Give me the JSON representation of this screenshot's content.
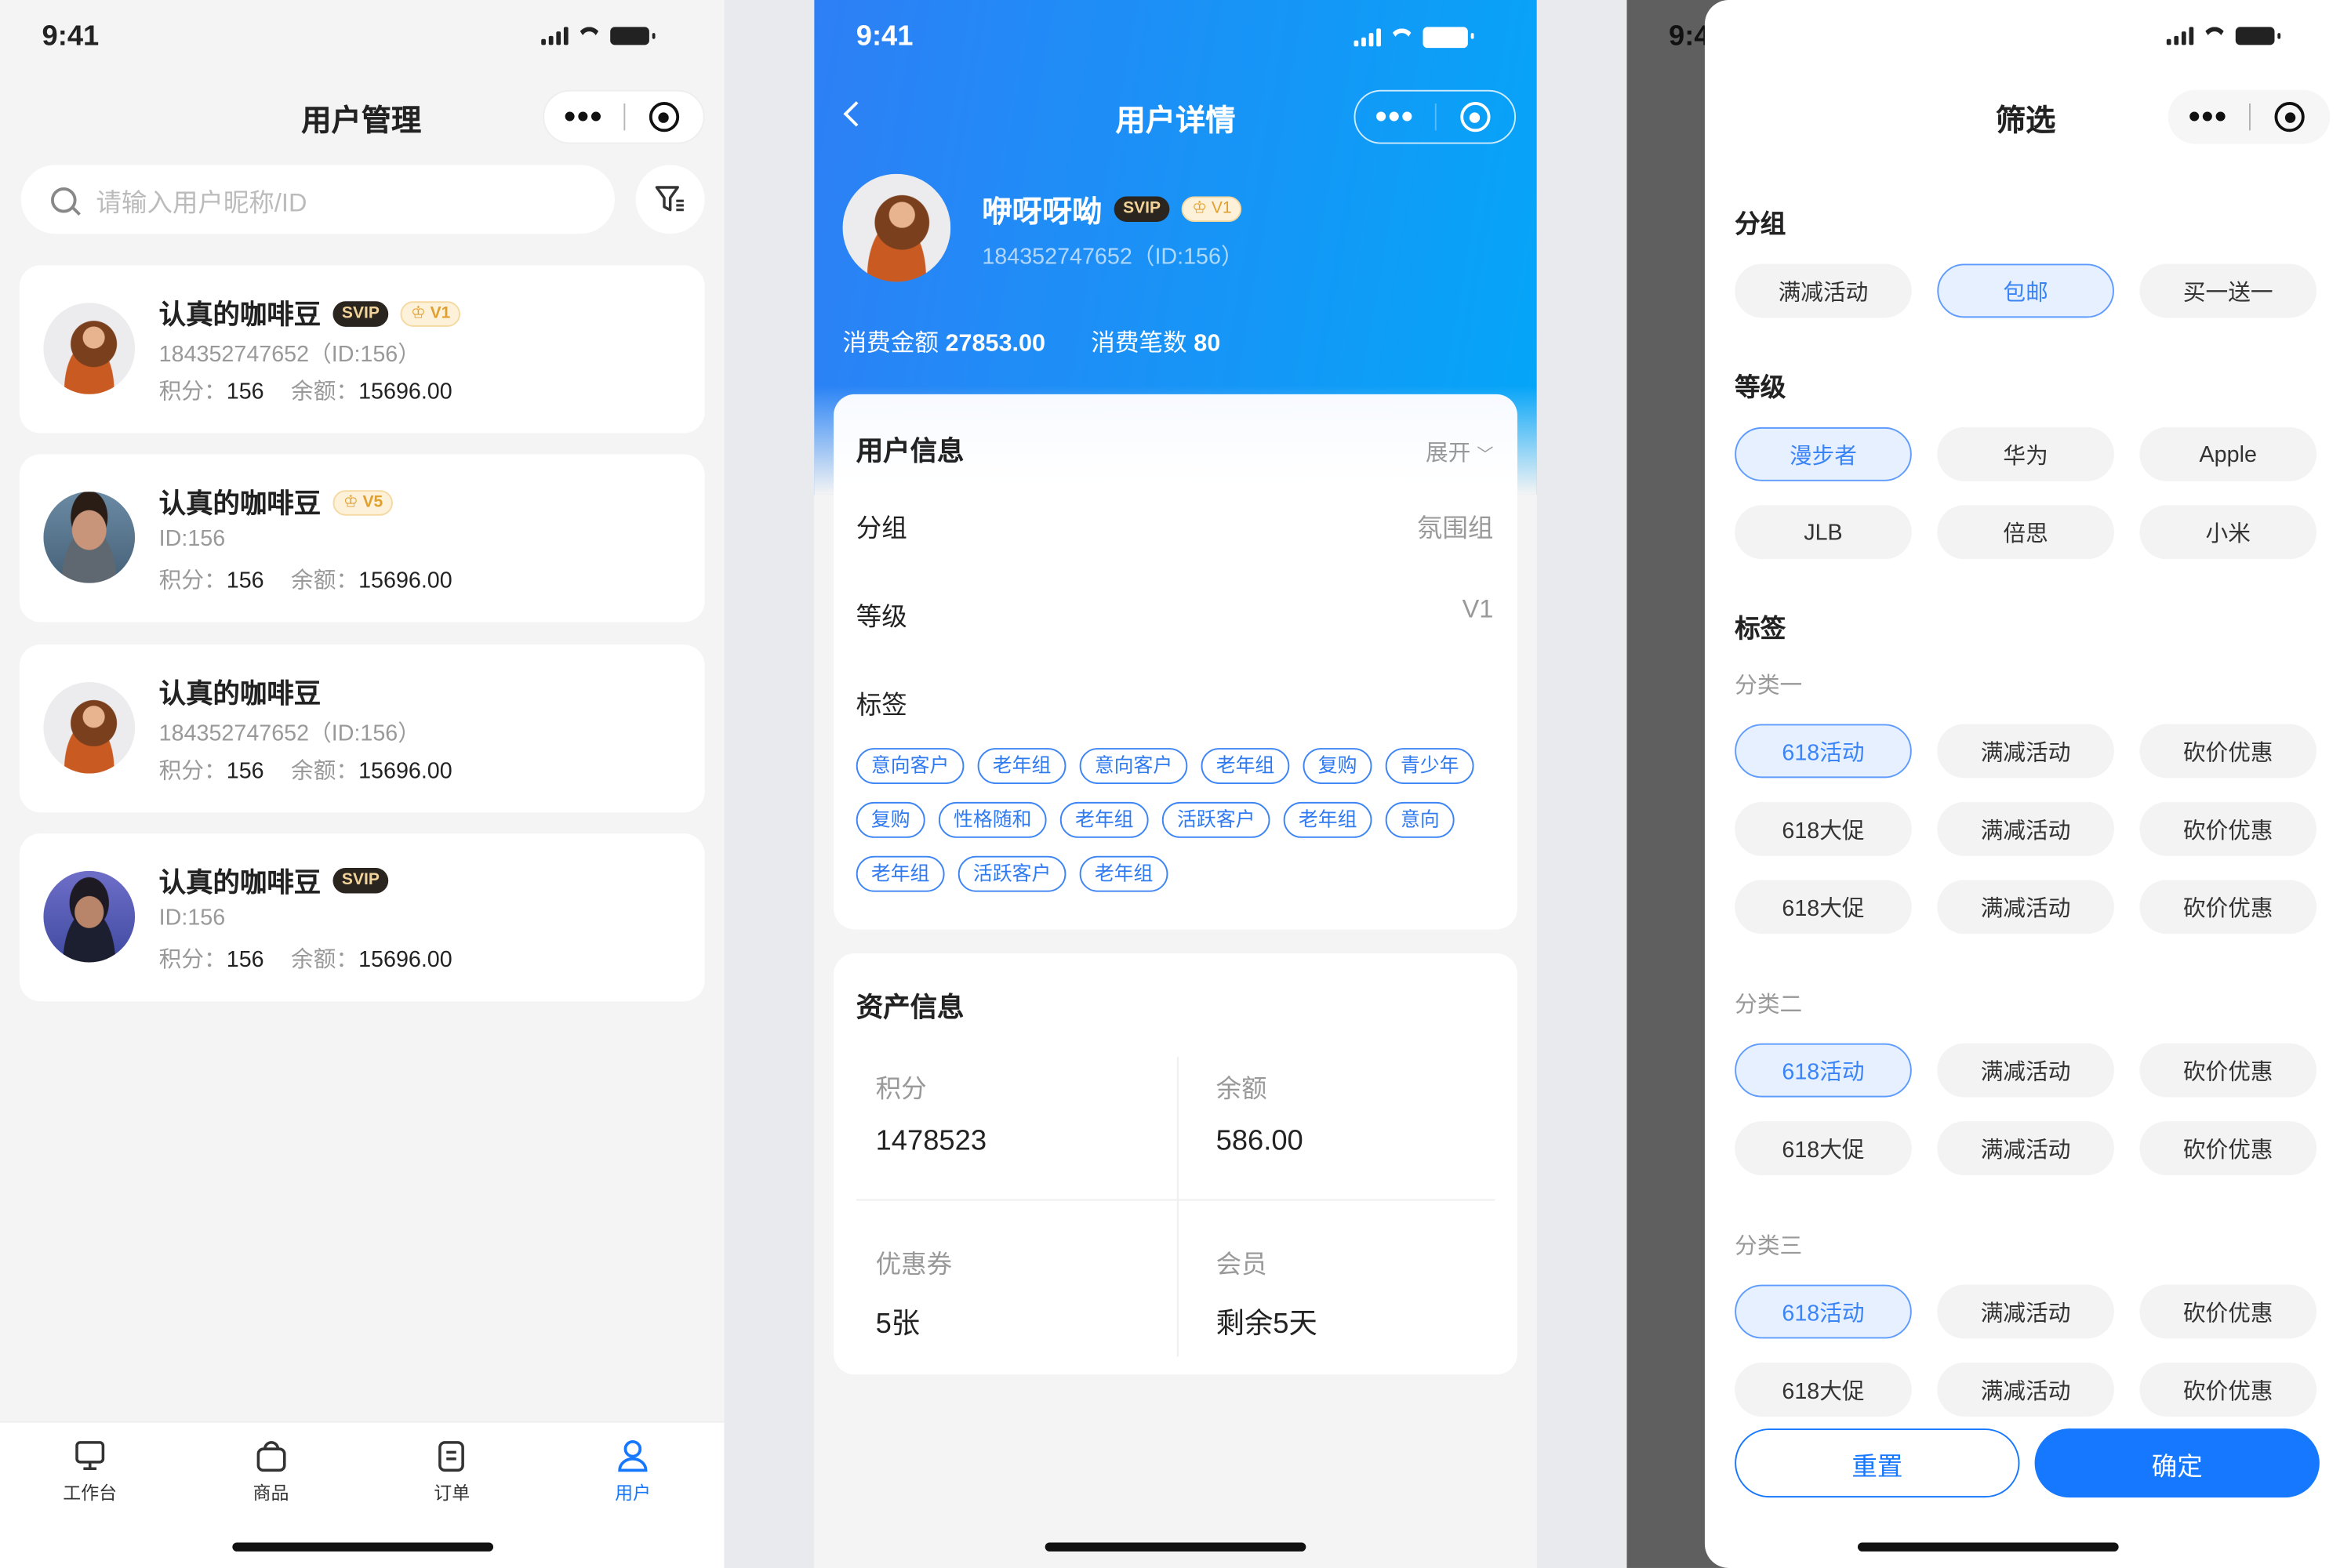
{
  "status": {
    "time": "9:41"
  },
  "list": {
    "title": "用户管理",
    "search_placeholder": "请输入用户昵称/ID",
    "users": [
      {
        "name": "认真的咖啡豆",
        "svip": "SVIP",
        "level": "V1",
        "id_line": "184352747652（ID:156）",
        "points_label": "积分：",
        "points": "156",
        "balance_label": "余额：",
        "balance": "15696.00",
        "avatar": "woman-orange"
      },
      {
        "name": "认真的咖啡豆",
        "svip": "",
        "level": "V5",
        "id_line": "ID:156",
        "points_label": "积分：",
        "points": "156",
        "balance_label": "余额：",
        "balance": "15696.00",
        "avatar": "man"
      },
      {
        "name": "认真的咖啡豆",
        "svip": "",
        "level": "",
        "id_line": "184352747652（ID:156）",
        "points_label": "积分：",
        "points": "156",
        "balance_label": "余额：",
        "balance": "15696.00",
        "avatar": "woman-orange"
      },
      {
        "name": "认真的咖啡豆",
        "svip": "SVIP",
        "level": "",
        "id_line": "ID:156",
        "points_label": "积分：",
        "points": "156",
        "balance_label": "余额：",
        "balance": "15696.00",
        "avatar": "woman-blue"
      }
    ],
    "tabbar": [
      {
        "label": "工作台",
        "icon": "workbench-icon",
        "active": false
      },
      {
        "label": "商品",
        "icon": "bag-icon",
        "active": false
      },
      {
        "label": "订单",
        "icon": "order-icon",
        "active": false
      },
      {
        "label": "用户",
        "icon": "user-icon",
        "active": true
      }
    ]
  },
  "detail": {
    "title": "用户详情",
    "name": "咿呀呀呦",
    "svip": "SVIP",
    "level": "V1",
    "id_line": "184352747652（ID:156）",
    "spend_label": "消费金额",
    "spend": "27853.00",
    "count_label": "消费笔数",
    "count": "80",
    "info": {
      "title": "用户信息",
      "expand": "展开",
      "rows": [
        {
          "label": "分组",
          "value": "氛围组"
        },
        {
          "label": "等级",
          "value": "V1"
        }
      ],
      "tags_label": "标签",
      "tags": [
        "意向客户",
        "老年组",
        "意向客户",
        "老年组",
        "复购",
        "青少年",
        "复购",
        "性格随和",
        "老年组",
        "活跃客户",
        "老年组",
        "意向",
        "老年组",
        "活跃客户",
        "老年组"
      ]
    },
    "assets": {
      "title": "资产信息",
      "items": [
        {
          "label": "积分",
          "value": "1478523"
        },
        {
          "label": "余额",
          "value": "586.00"
        },
        {
          "label": "优惠券",
          "value": "5张"
        },
        {
          "label": "会员",
          "value": "剩余5天"
        }
      ]
    }
  },
  "filter": {
    "title": "筛选",
    "sections": [
      {
        "title": "分组",
        "chips": [
          {
            "label": "满减活动",
            "selected": false
          },
          {
            "label": "包邮",
            "selected": true
          },
          {
            "label": "买一送一",
            "selected": false
          }
        ]
      },
      {
        "title": "等级",
        "chips": [
          {
            "label": "漫步者",
            "selected": true
          },
          {
            "label": "华为",
            "selected": false
          },
          {
            "label": "Apple",
            "selected": false
          },
          {
            "label": "JLB",
            "selected": false
          },
          {
            "label": "倍思",
            "selected": false
          },
          {
            "label": "小米",
            "selected": false
          }
        ]
      },
      {
        "title": "标签",
        "groups": [
          {
            "title": "分类一",
            "chips": [
              {
                "label": "618活动",
                "selected": true
              },
              {
                "label": "满减活动",
                "selected": false
              },
              {
                "label": "砍价优惠",
                "selected": false
              },
              {
                "label": "618大促",
                "selected": false
              },
              {
                "label": "满减活动",
                "selected": false
              },
              {
                "label": "砍价优惠",
                "selected": false
              },
              {
                "label": "618大促",
                "selected": false
              },
              {
                "label": "满减活动",
                "selected": false
              },
              {
                "label": "砍价优惠",
                "selected": false
              }
            ]
          },
          {
            "title": "分类二",
            "chips": [
              {
                "label": "618活动",
                "selected": true
              },
              {
                "label": "满减活动",
                "selected": false
              },
              {
                "label": "砍价优惠",
                "selected": false
              },
              {
                "label": "618大促",
                "selected": false
              },
              {
                "label": "满减活动",
                "selected": false
              },
              {
                "label": "砍价优惠",
                "selected": false
              }
            ]
          },
          {
            "title": "分类三",
            "chips": [
              {
                "label": "618活动",
                "selected": true
              },
              {
                "label": "满减活动",
                "selected": false
              },
              {
                "label": "砍价优惠",
                "selected": false
              },
              {
                "label": "618大促",
                "selected": false
              },
              {
                "label": "满减活动",
                "selected": false
              },
              {
                "label": "砍价优惠",
                "selected": false
              }
            ]
          }
        ]
      }
    ],
    "reset": "重置",
    "confirm": "确定"
  },
  "colors": {
    "primary": "#1677ff",
    "page_bg": "#f4f4f4",
    "vip_gold": "#e0a030"
  }
}
